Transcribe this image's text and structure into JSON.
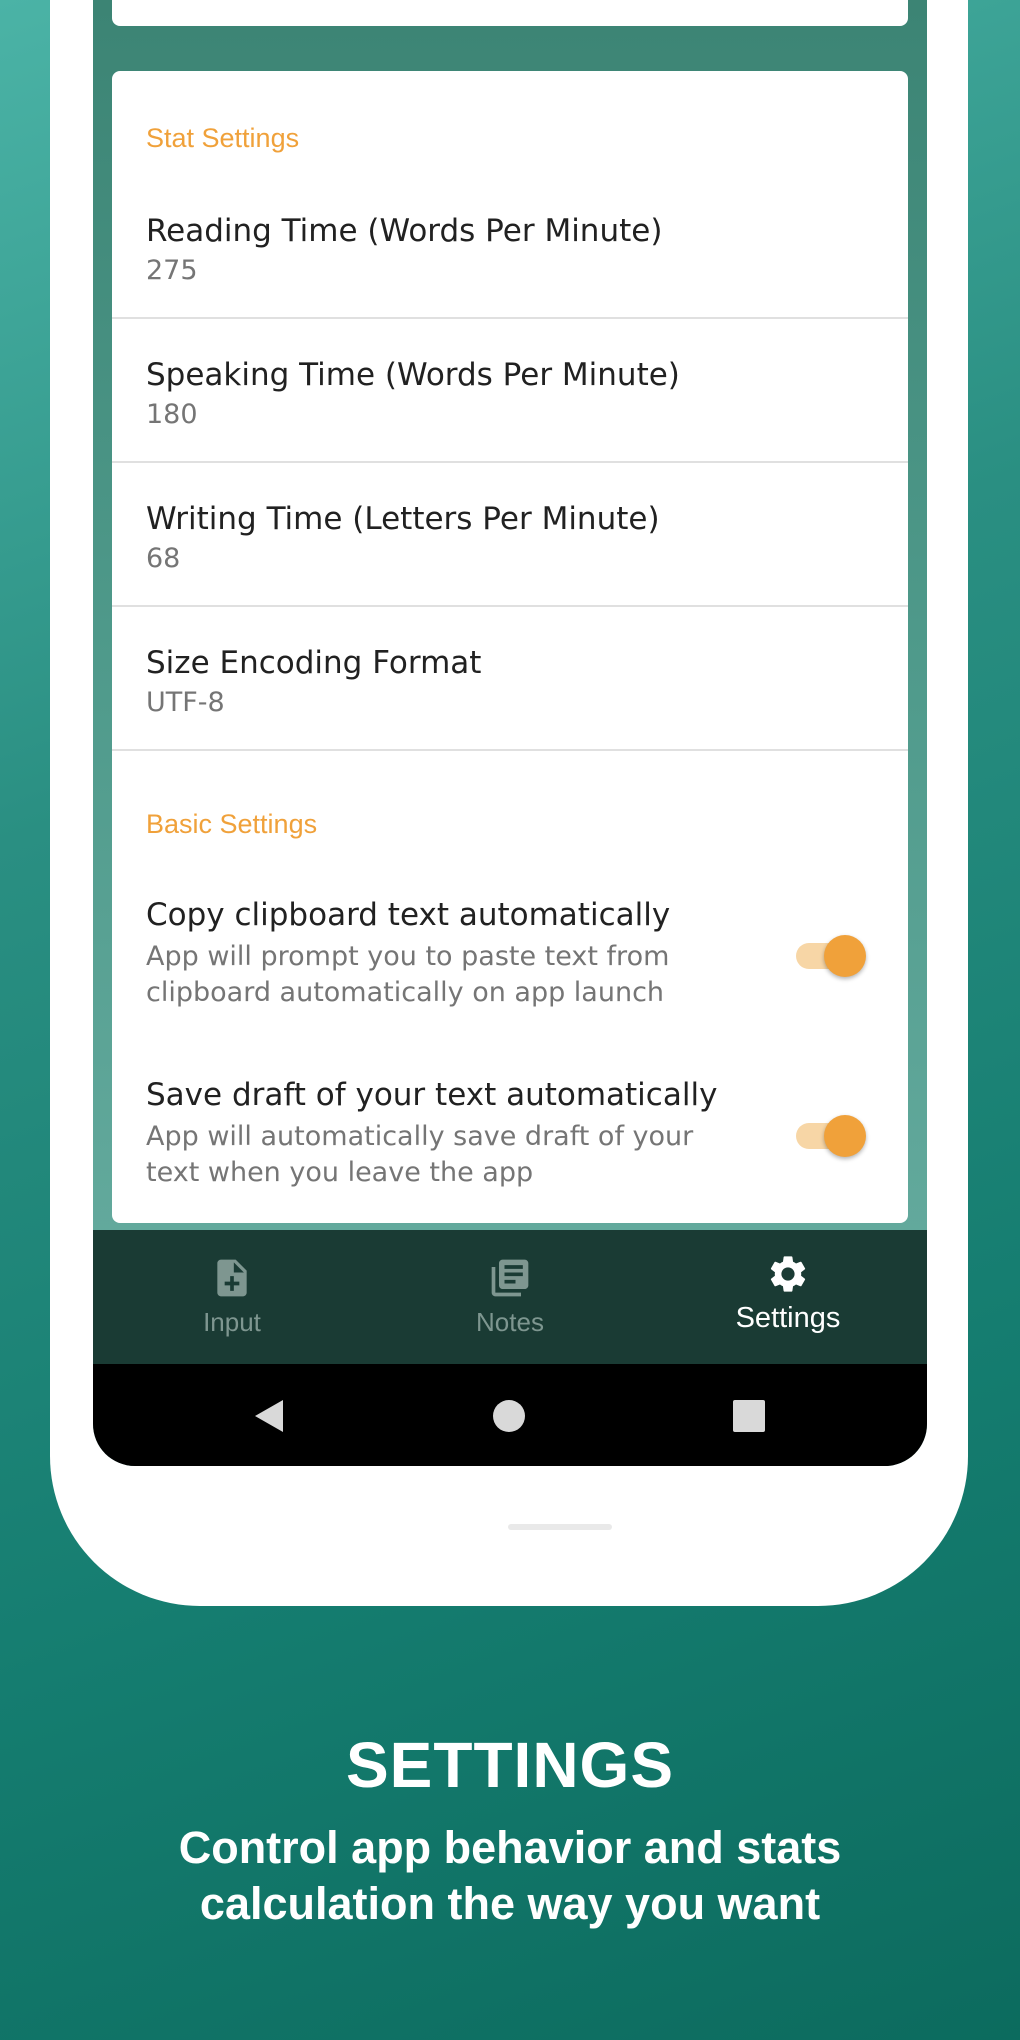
{
  "stat_settings": {
    "header": "Stat Settings",
    "items": [
      {
        "title": "Reading Time (Words Per Minute)",
        "value": "275"
      },
      {
        "title": "Speaking Time (Words Per Minute)",
        "value": "180"
      },
      {
        "title": "Writing Time (Letters Per Minute)",
        "value": "68"
      },
      {
        "title": "Size Encoding Format",
        "value": "UTF-8"
      }
    ]
  },
  "basic_settings": {
    "header": "Basic Settings",
    "items": [
      {
        "title": "Copy clipboard text automatically",
        "summary": "App will prompt you to paste text from clipboard automatically on app launch",
        "enabled": true
      },
      {
        "title": "Save draft of your text automatically",
        "summary": "App will automatically save draft of your text when you leave the app",
        "enabled": true
      }
    ]
  },
  "bottom_nav": {
    "items": [
      {
        "label": "Input",
        "icon": "note-add-icon",
        "active": false
      },
      {
        "label": "Notes",
        "icon": "library-books-icon",
        "active": false
      },
      {
        "label": "Settings",
        "icon": "gear-icon",
        "active": true
      }
    ]
  },
  "system_nav": {
    "buttons": [
      "back-icon",
      "home-icon",
      "recents-icon"
    ]
  },
  "promo": {
    "title": "SETTINGS",
    "subtitle": "Control app behavior and stats calculation the way you want"
  },
  "colors": {
    "accent": "#f0a13a",
    "nav_background": "#1a3b34",
    "background_gradient_start": "#4bb3a6",
    "background_gradient_end": "#0c6b5e"
  }
}
